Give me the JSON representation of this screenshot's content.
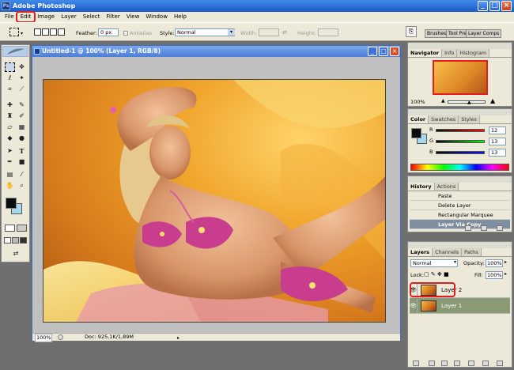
{
  "window": {
    "title": "Adobe Photoshop",
    "icon_text": "Ps"
  },
  "menu": [
    "File",
    "Edit",
    "Image",
    "Layer",
    "Select",
    "Filter",
    "View",
    "Window",
    "Help"
  ],
  "options": {
    "feather_label": "Feather:",
    "feather_value": "0 px",
    "antialias_label": "Antialias",
    "style_label": "Style:",
    "style_value": "Normal",
    "width_label": "Width:",
    "height_label": "Height:"
  },
  "palette_well": [
    "Brushes",
    "Tool Presets",
    "Layer Comps"
  ],
  "document": {
    "title": "Untitled-1 @ 100% (Layer 1, RGB/8)",
    "zoom": "100%",
    "doc_info": "Doc: 925,1K/1,89M"
  },
  "navigator": {
    "tabs": [
      "Navigator",
      "Info",
      "Histogram"
    ],
    "zoom": "100%"
  },
  "color": {
    "tabs": [
      "Color",
      "Swatches",
      "Styles"
    ],
    "r_label": "R",
    "r_value": "12",
    "g_label": "G",
    "g_value": "13",
    "b_label": "B",
    "b_value": "13",
    "foreground": "#0c0d0d",
    "background": "#a8d8f0"
  },
  "history": {
    "tabs": [
      "History",
      "Actions"
    ],
    "items": [
      "Paste",
      "Delete Layer",
      "Rectangular Marquee",
      "Layer Via Copy"
    ]
  },
  "layers": {
    "tabs": [
      "Layers",
      "Channels",
      "Paths"
    ],
    "blend_mode": "Normal",
    "opacity_label": "Opacity:",
    "opacity_value": "100%",
    "lock_label": "Lock:",
    "fill_label": "Fill:",
    "fill_value": "100%",
    "items": [
      "Layer 2",
      "Layer 1"
    ],
    "highlight_color": "#e51c1c"
  }
}
